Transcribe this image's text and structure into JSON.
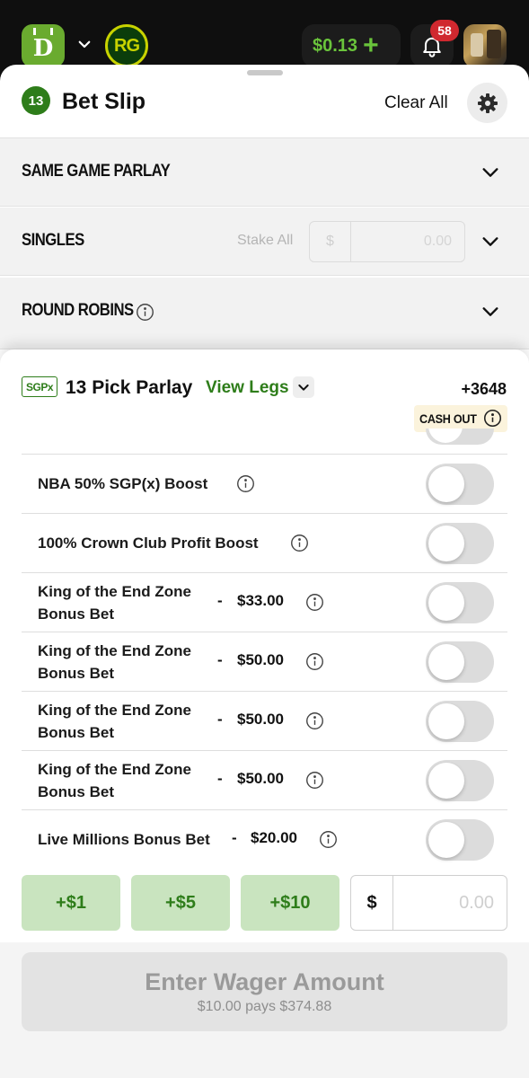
{
  "topbar": {
    "logo_letter": "D",
    "rg_logo": "RG",
    "balance": "$0.13",
    "balance_add": "+",
    "notifications_count": "58"
  },
  "betslip": {
    "count": "13",
    "title": "Bet Slip",
    "clear_all": "Clear All"
  },
  "sections": [
    {
      "label": "SAME GAME PARLAY"
    },
    {
      "label": "SINGLES",
      "stake_all_label": "Stake All",
      "stake_currency": "$",
      "stake_value": "0.00"
    },
    {
      "label": "ROUND ROBINS"
    }
  ],
  "parlay": {
    "tag": "SGPx",
    "title": "13 Pick Parlay",
    "view_legs": "View Legs",
    "odds": "+3648",
    "cash_out": "CASH OUT"
  },
  "boosts": [
    {
      "name": "NBA 50% SGP(x) Boost",
      "enabled": false
    },
    {
      "name": "100% Crown Club Profit Boost",
      "enabled": false
    },
    {
      "name_line1": "King of the End Zone",
      "name_line2": "Bonus Bet",
      "dash": "-",
      "amount": "$33.00",
      "enabled": false
    },
    {
      "name_line1": "King of the End Zone",
      "name_line2": "Bonus Bet",
      "dash": "-",
      "amount": "$50.00",
      "enabled": false
    },
    {
      "name_line1": "King of the End Zone",
      "name_line2": "Bonus Bet",
      "dash": "-",
      "amount": "$50.00",
      "enabled": false
    },
    {
      "name_line1": "King of the End Zone",
      "name_line2": "Bonus Bet",
      "dash": "-",
      "amount": "$50.00",
      "enabled": false
    },
    {
      "name": "Live Millions Bonus Bet",
      "dash": "-",
      "amount": "$20.00",
      "enabled": false
    }
  ],
  "quick_stakes": [
    "+$1",
    "+$5",
    "+$10"
  ],
  "wager": {
    "currency": "$",
    "placeholder": "0.00"
  },
  "submit": {
    "label": "Enter Wager Amount",
    "payout": "$10.00 pays $374.88"
  },
  "colors": {
    "brand_green": "#2e7d1a",
    "balance_green": "#6ac43b",
    "quick_stake_bg": "#c9e4bf",
    "badge_red": "#d0282f"
  }
}
